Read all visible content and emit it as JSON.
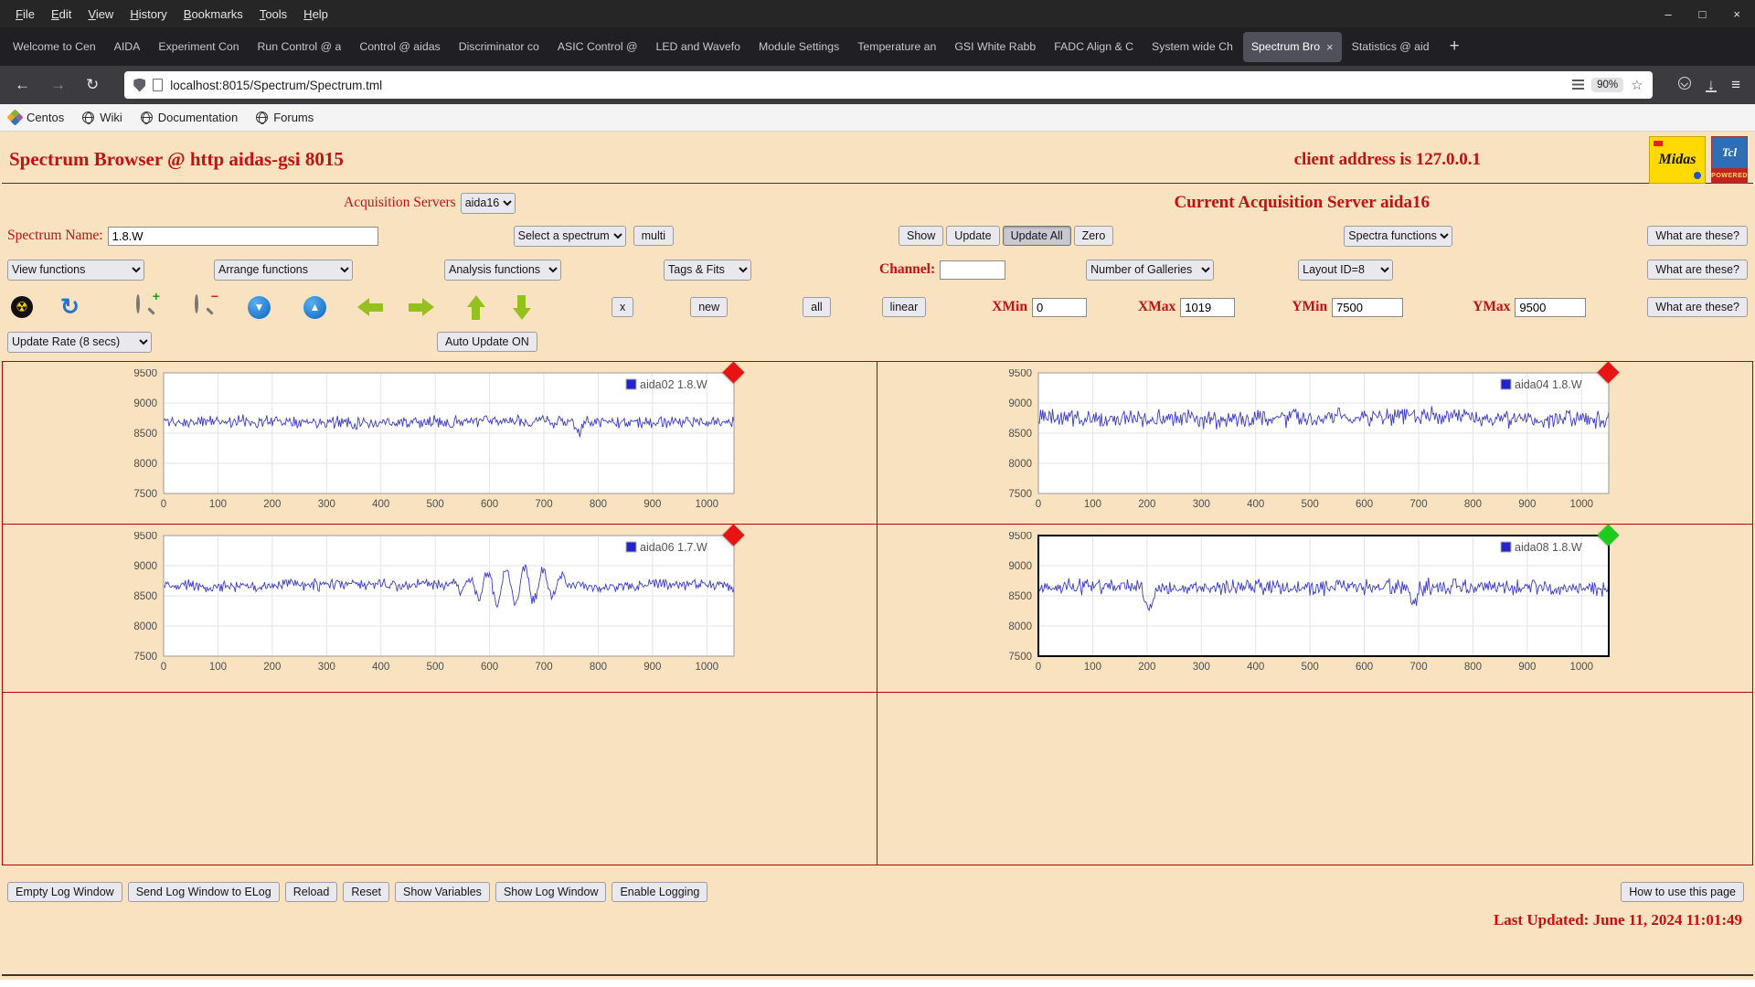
{
  "colors": {
    "accent_red": "#c31111",
    "page_bg": "#f8e2bf",
    "grid_border": "#b40000",
    "arrow_green": "#95c11f",
    "line_blue": "#3a3ad2",
    "legend_blue": "#2424cc",
    "marker_red": "#e81313",
    "marker_green": "#1dcb1d"
  },
  "window": {
    "menu": [
      "File",
      "Edit",
      "View",
      "History",
      "Bookmarks",
      "Tools",
      "Help"
    ],
    "controls": [
      {
        "name": "minimize",
        "glyph": "–"
      },
      {
        "name": "maximize",
        "glyph": "□"
      },
      {
        "name": "close",
        "glyph": "×"
      }
    ]
  },
  "tabs": {
    "items": [
      "Welcome to Cen",
      "AIDA",
      "Experiment Con",
      "Run Control @ a",
      "Control @ aidas",
      "Discriminator co",
      "ASIC Control @",
      "LED and Wavefo",
      "Module Settings",
      "Temperature an",
      "GSI White Rabb",
      "FADC Align & C",
      "System wide Ch",
      "Spectrum Bro",
      "Statistics @ aid"
    ],
    "active_index": 13,
    "close_glyph": "×",
    "new_tab_glyph": "+"
  },
  "navbar": {
    "back_glyph": "←",
    "forward_glyph": "→",
    "reload_glyph": "↻",
    "url": "localhost:8015/Spectrum/Spectrum.tml",
    "zoom": "90%",
    "star_glyph": "☆",
    "downloads_glyph": "↓",
    "menu_glyph": "≡"
  },
  "bookmarks": [
    {
      "label": "Centos",
      "icon": "centos"
    },
    {
      "label": "Wiki",
      "icon": "globe"
    },
    {
      "label": "Documentation",
      "icon": "globe"
    },
    {
      "label": "Forums",
      "icon": "globe"
    }
  ],
  "icons": {
    "radiation": "☢",
    "refresh": "↻",
    "plus": "+",
    "minus": "−",
    "blue_down": "▼",
    "blue_up": "▲"
  },
  "page": {
    "title": "Spectrum Browser @ http aidas-gsi 8015",
    "client": "client address is 127.0.0.1",
    "logos": {
      "midas": "Midas",
      "tcl_top": "Tcl",
      "tcl_bottom": "POWERED"
    },
    "acquisition": {
      "label": "Acquisition Servers",
      "server": "aida16",
      "current": "Current Acquisition Server aida16"
    },
    "common": {
      "what": "What are these?"
    },
    "row_spectrum": {
      "name_label": "Spectrum Name:",
      "name_value": "1.8.W",
      "select_spectrum": "Select a spectrum",
      "multi": "multi",
      "show": "Show",
      "update": "Update",
      "update_all": "Update All",
      "zero": "Zero",
      "spectra_functions": "Spectra functions"
    },
    "row_functions": {
      "view": "View functions",
      "arrange": "Arrange functions",
      "analysis": "Analysis functions",
      "tags": "Tags & Fits",
      "channel_label": "Channel:",
      "channel_value": "",
      "galleries": "Number of Galleries",
      "layout": "Layout ID=8"
    },
    "row_range": {
      "x_button": "x",
      "new": "new",
      "all": "all",
      "linear": "linear",
      "xmin_label": "XMin",
      "xmin": "0",
      "xmax_label": "XMax",
      "xmax": "1019",
      "ymin_label": "YMin",
      "ymin": "7500",
      "ymax_label": "YMax",
      "ymax": "9500"
    },
    "row_update": {
      "rate": "Update Rate (8 secs)",
      "auto": "Auto Update ON"
    },
    "footer": {
      "buttons": [
        "Empty Log Window",
        "Send Log Window to ELog",
        "Reload",
        "Reset",
        "Show Variables",
        "Show Log Window",
        "Enable Logging"
      ],
      "help": "How to use this page",
      "last_updated": "Last Updated: June 11, 2024 11:01:49"
    }
  },
  "chart_data": {
    "type": "line",
    "axes": {
      "xlim": [
        0,
        1050
      ],
      "ylim": [
        7500,
        9500
      ],
      "x_ticks": [
        0,
        100,
        200,
        300,
        400,
        500,
        600,
        700,
        800,
        900,
        1000
      ],
      "y_ticks": [
        7500,
        8000,
        8500,
        9000,
        9500
      ],
      "grid": true,
      "legend_position": "top-right"
    },
    "charts": [
      {
        "legend": "aida02 1.8.W",
        "seed": 11,
        "baseline": 8690,
        "noise": 120,
        "slow": 25,
        "burst": null,
        "spikes": [
          {
            "x": 765,
            "amp": -160
          }
        ],
        "marker_color": "#e81313",
        "selected": false
      },
      {
        "legend": "aida04 1.8.W",
        "seed": 23,
        "baseline": 8755,
        "noise": 180,
        "slow": 35,
        "burst": null,
        "spikes": [],
        "marker_color": "#e81313",
        "selected": false
      },
      {
        "legend": "aida06 1.7.W",
        "seed": 37,
        "baseline": 8660,
        "noise": 110,
        "slow": 55,
        "burst": {
          "from": 520,
          "to": 770,
          "amp": 300,
          "period": 34
        },
        "spikes": [],
        "marker_color": "#e81313",
        "selected": false
      },
      {
        "legend": "aida08 1.8.W",
        "seed": 49,
        "baseline": 8635,
        "noise": 160,
        "slow": 35,
        "burst": null,
        "spikes": [
          {
            "x": 205,
            "amp": -420
          },
          {
            "x": 690,
            "amp": -280
          }
        ],
        "marker_color": "#1dcb1d",
        "selected": true
      }
    ]
  }
}
